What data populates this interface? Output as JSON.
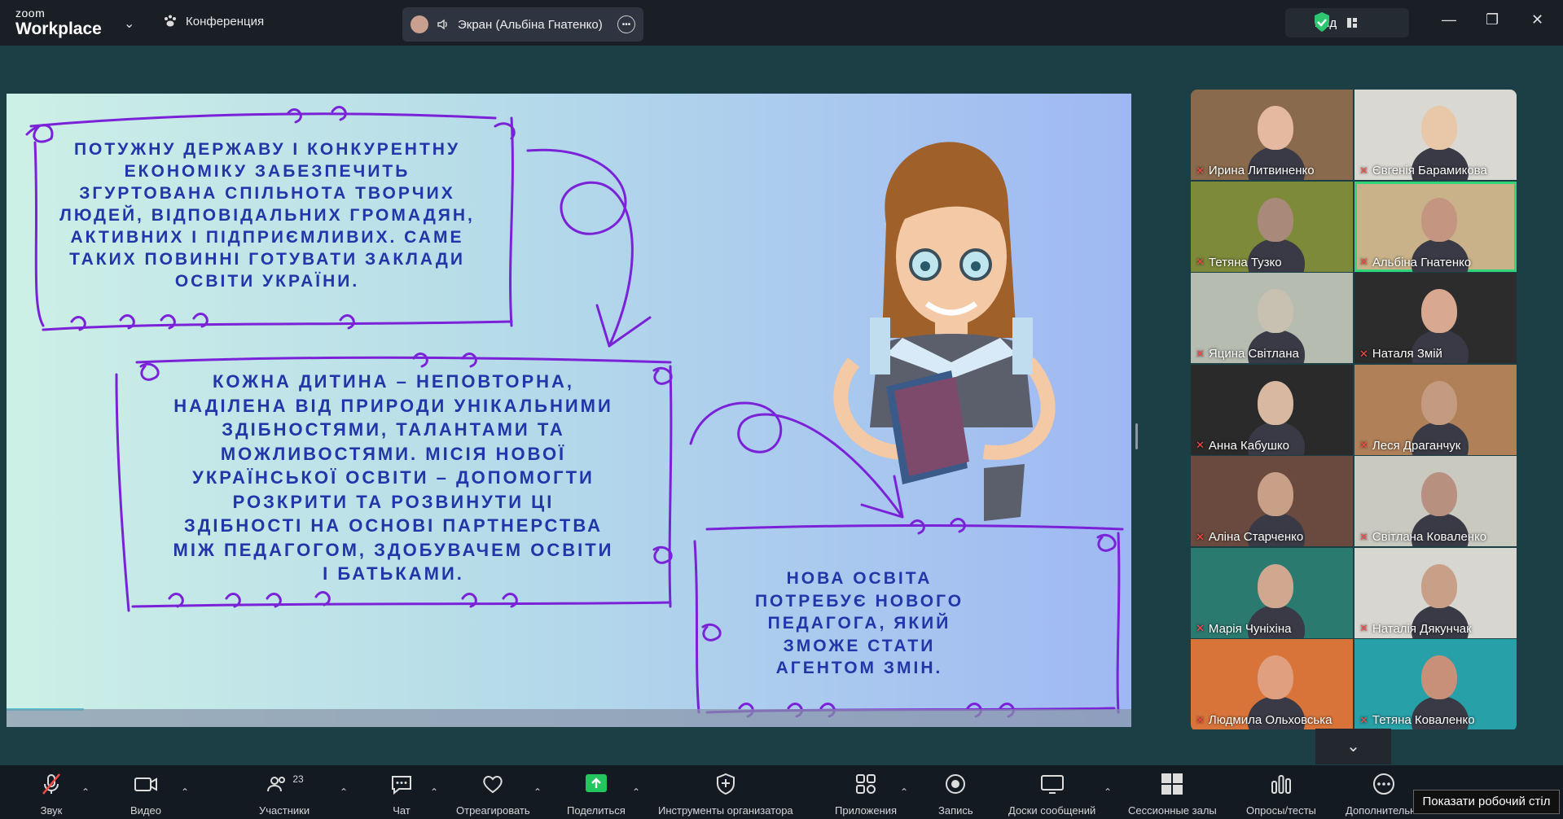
{
  "app": {
    "brand_top": "zoom",
    "brand_bottom": "Workplace"
  },
  "header": {
    "conference_label": "Конференция",
    "share_label": "Экран (Альбіна Гнатенко)",
    "view_label": "Вид"
  },
  "slide": {
    "text1": "ПОТУЖНУ ДЕРЖАВУ І КОНКУРЕНТНУ ЕКОНОМІКУ ЗАБЕЗПЕЧИТЬ ЗГУРТОВАНА СПІЛЬНОТА ТВОРЧИХ ЛЮДЕЙ, ВІДПОВІДАЛЬНИХ ГРОМАДЯН, АКТИВНИХ І ПІДПРИЄМЛИВИХ. САМЕ ТАКИХ ПОВИННІ ГОТУВАТИ ЗАКЛАДИ ОСВІТИ  УКРАЇНИ.",
    "text2": "КОЖНА ДИТИНА – НЕПОВТОРНА, НАДІЛЕНА ВІД ПРИРОДИ УНІКАЛЬНИМИ ЗДІБНОСТЯМИ, ТАЛАНТАМИ ТА МОЖЛИВОСТЯМИ. МІСІЯ НОВОЇ УКРАЇНСЬКОЇ ОСВІТИ – ДОПОМОГТИ РОЗКРИТИ ТА РОЗВИНУТИ ЦІ ЗДІБНОСТІ НА ОСНОВІ ПАРТНЕРСТВА МІЖ ПЕДАГОГОМ, ЗДОБУВАЧЕМ ОСВІТИ І БАТЬКАМИ.",
    "text3": "НОВА ОСВІТА ПОТРЕБУЄ НОВОГО ПЕДАГОГА, ЯКИЙ ЗМОЖЕ СТАТИ АГЕНТОМ ЗМІН."
  },
  "participants": [
    {
      "name": "Ирина Литвиненко",
      "bg": "#8a6a4c",
      "face": "#e5b9a0",
      "active": false
    },
    {
      "name": "Євгенія Барамикова",
      "bg": "#d9d8d2",
      "face": "#e8c8a8",
      "active": false
    },
    {
      "name": "Тетяна Тузко",
      "bg": "#7c8a3a",
      "face": "#a98a7a",
      "active": false
    },
    {
      "name": "Альбіна Гнатенко",
      "bg": "#c9b28a",
      "face": "#c49580",
      "active": true
    },
    {
      "name": "Яцина Світлана",
      "bg": "#b7bcb1",
      "face": "#c8c0b0",
      "active": false
    },
    {
      "name": "Наталя Змій",
      "bg": "#2c2c2c",
      "face": "#d8a890",
      "active": false
    },
    {
      "name": "Анна Кабушко",
      "bg": "#2a2a2a",
      "face": "#d8b8a0",
      "active": false
    },
    {
      "name": "Леся Драганчук",
      "bg": "#b08058",
      "face": "#c49a80",
      "active": false
    },
    {
      "name": "Аліна Старченко",
      "bg": "#6a4a3e",
      "face": "#c8a088",
      "active": false
    },
    {
      "name": "Світлана Коваленко",
      "bg": "#c9c9c0",
      "face": "#b89080",
      "active": false
    },
    {
      "name": "Марія Чуніхіна",
      "bg": "#2a7a70",
      "face": "#d0a890",
      "active": false
    },
    {
      "name": "Наталія Дякунчак",
      "bg": "#d8d6d0",
      "face": "#c8a088",
      "active": false
    },
    {
      "name": "Людмила Ольховська",
      "bg": "#d8743a",
      "face": "#e0a080",
      "active": false
    },
    {
      "name": "Тетяна  Коваленко",
      "bg": "#28a0a8",
      "face": "#c89078",
      "active": false
    }
  ],
  "toolbar": {
    "audio": "Звук",
    "video": "Видео",
    "participants": "Участники",
    "participants_count": "23",
    "chat": "Чат",
    "react": "Отреагировать",
    "share": "Поделиться",
    "host_tools": "Инструменты организатора",
    "apps": "Приложения",
    "record": "Запись",
    "whiteboards": "Доски сообщений",
    "breakout": "Сессионные залы",
    "polls": "Опросы/тесты",
    "more": "Дополнительно"
  },
  "tooltip": "Показати робочий стіл",
  "icons": [
    "mic-muted-icon",
    "video-icon",
    "participants-icon",
    "chat-icon",
    "heart-icon",
    "share-screen-icon",
    "shield-icon",
    "apps-icon",
    "record-icon",
    "whiteboard-icon",
    "breakout-icon",
    "polls-icon",
    "more-icon",
    "chevron-down-icon"
  ]
}
